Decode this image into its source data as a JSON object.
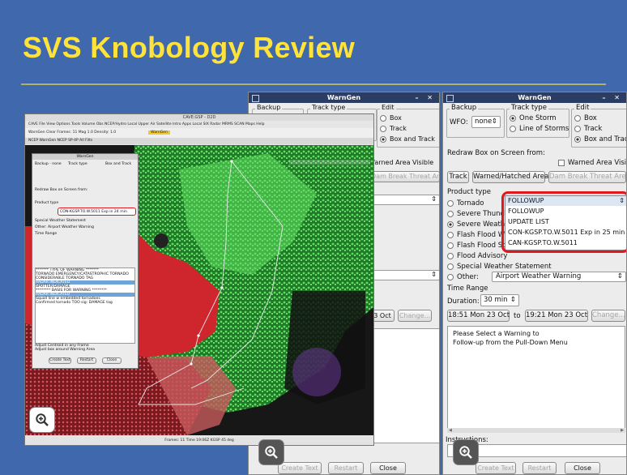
{
  "slide": {
    "title": "SVS Knobology Review"
  },
  "colors": {
    "background": "#3f68ad",
    "title": "#ffe33a",
    "highlight": "#e0181d",
    "titlebar": "#2b3d63"
  },
  "warngen": {
    "title": "WarnGen",
    "backup_label": "Backup",
    "wfo_label": "WFO:",
    "wfo_value": "none",
    "track_type_label": "Track type",
    "track_one_storm": "One Storm",
    "track_line": "Line of Storms",
    "edit_label": "Edit",
    "edit_box": "Box",
    "edit_track": "Track",
    "edit_box_track": "Box and Track",
    "redraw_label": "Redraw Box on Screen from:",
    "warned_area": "Warned Area Visible",
    "btn_track": "Track",
    "btn_warned": "Warned/Hatched Area",
    "btn_dam": "Dam Break Threat Area",
    "product_type_label": "Product type",
    "products": [
      "Tornado",
      "Severe Thunder",
      "Severe Weather",
      "Flash Flood War",
      "Flash Flood Sta",
      "Flood Advisory",
      "Special Weather Statement"
    ],
    "other_label": "Other:",
    "other_value": "Airport Weather Warning",
    "followup_value": "FOLLOWUP",
    "followup_options": [
      "FOLLOWUP",
      "UPDATE LIST",
      "CON-KGSP.TO.W.5011 Exp in 25 min",
      "CAN-KGSP.TO.W.5011"
    ],
    "time_range_label": "Time Range",
    "duration_label": "Duration:",
    "duration_value": "30 min",
    "start_time": "18:51 Mon 23 Oct",
    "to_label": "to",
    "end_time": "19:21 Mon 23 Oct",
    "change_label": "Change...",
    "message_line1": "Please Select a Warning to",
    "message_line2": "Follow-up from the Pull-Down Menu",
    "instructions_label": "Instructions:",
    "create_text": "Create Text",
    "restart": "Restart",
    "close": "Close"
  },
  "middle": {
    "mid_start": "3 Oct",
    "change": "Change...",
    "create_text": "Create Text",
    "restart": "Restart",
    "close": "Close"
  },
  "cave": {
    "title": "CAVE:GSP - D2D",
    "menu": "CAVE  File  View  Options  Tools  Volume  Obs  NCEP/Hydro  Local  Upper Air  Satellite  Intro  Apps  Local  SIX  Radar  MRMS  SCAN  Maps  Help",
    "toolbar": "WarnGen  Clear  Frames: 11  Mag 1.0  Density: 1.0",
    "tabs": "NCEP WarnGen  NCEP SP-4P All Filts",
    "statusbar": "Frames: 11  Time 19:06Z   KGSP 45 deg",
    "prod_text": "CON-KGSP.TO.W.5011 Exp in 24 min",
    "list_rows": [
      "******* TYPE OF WARNING *******",
      "TORNADO EMERGENCY/CATASTROPHIC TORNADO",
      "CONSIDERABLE TORNADO TAG",
      "RADAR INDICATED",
      "SPOTTER/DAMAGE",
      "******** BASIS FOR WARNING ********",
      "RADAR INDICATED",
      "Squall line w embedded tornadoes",
      "Confirmed tornado TOO sig: DAMAGE tag"
    ],
    "instructions": [
      "Adjust Centroid in any Frame",
      "Adjust box around Warning Area"
    ],
    "btn_create": "Create Text",
    "btn_restart": "Restart",
    "btn_close": "Close",
    "mini_warngen_title": "WarnGen"
  }
}
